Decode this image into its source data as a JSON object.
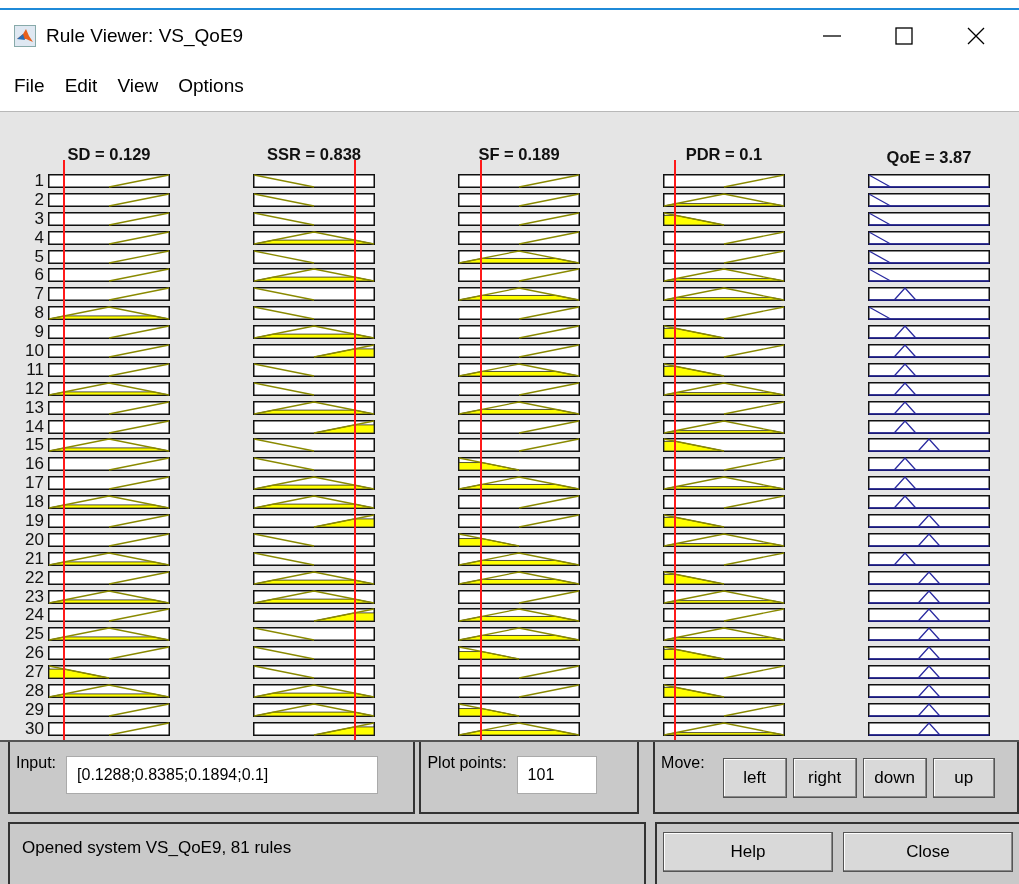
{
  "window": {
    "title": "Rule Viewer: VS_QoE9"
  },
  "menu": [
    "File",
    "Edit",
    "View",
    "Options"
  ],
  "inputs": [
    {
      "label": "SD = 0.129"
    },
    {
      "label": "SSR = 0.838"
    },
    {
      "label": "SF = 0.189"
    },
    {
      "label": "PDR = 0.1"
    }
  ],
  "output": {
    "label": "QoE = 3.87"
  },
  "rules": [
    {
      "number": "1",
      "cells": [
        {
          "kind": "high"
        },
        {
          "kind": "low"
        },
        {
          "kind": "high"
        },
        {
          "kind": "high"
        },
        {
          "kind": "falling"
        }
      ]
    },
    {
      "number": "2",
      "cells": [
        {
          "kind": "high"
        },
        {
          "kind": "low"
        },
        {
          "kind": "high"
        },
        {
          "kind": "mid"
        },
        {
          "kind": "falling"
        }
      ]
    },
    {
      "number": "3",
      "cells": [
        {
          "kind": "high"
        },
        {
          "kind": "low"
        },
        {
          "kind": "high"
        },
        {
          "kind": "low"
        },
        {
          "kind": "falling"
        }
      ]
    },
    {
      "number": "4",
      "cells": [
        {
          "kind": "high"
        },
        {
          "kind": "mid"
        },
        {
          "kind": "high"
        },
        {
          "kind": "high"
        },
        {
          "kind": "falling"
        }
      ]
    },
    {
      "number": "5",
      "cells": [
        {
          "kind": "high"
        },
        {
          "kind": "low"
        },
        {
          "kind": "mid"
        },
        {
          "kind": "high"
        },
        {
          "kind": "falling"
        }
      ]
    },
    {
      "number": "6",
      "cells": [
        {
          "kind": "high"
        },
        {
          "kind": "mid"
        },
        {
          "kind": "high"
        },
        {
          "kind": "mid"
        },
        {
          "kind": "falling"
        }
      ]
    },
    {
      "number": "7",
      "cells": [
        {
          "kind": "high"
        },
        {
          "kind": "low"
        },
        {
          "kind": "mid"
        },
        {
          "kind": "mid"
        },
        {
          "kind": "lowpeak"
        }
      ]
    },
    {
      "number": "8",
      "cells": [
        {
          "kind": "mid"
        },
        {
          "kind": "low"
        },
        {
          "kind": "high"
        },
        {
          "kind": "high"
        },
        {
          "kind": "falling"
        }
      ]
    },
    {
      "number": "9",
      "cells": [
        {
          "kind": "high"
        },
        {
          "kind": "mid"
        },
        {
          "kind": "high"
        },
        {
          "kind": "low"
        },
        {
          "kind": "lowpeak"
        }
      ]
    },
    {
      "number": "10",
      "cells": [
        {
          "kind": "high"
        },
        {
          "kind": "high"
        },
        {
          "kind": "high"
        },
        {
          "kind": "high"
        },
        {
          "kind": "lowpeak"
        }
      ]
    },
    {
      "number": "11",
      "cells": [
        {
          "kind": "high"
        },
        {
          "kind": "low"
        },
        {
          "kind": "mid"
        },
        {
          "kind": "low"
        },
        {
          "kind": "lowpeak"
        }
      ]
    },
    {
      "number": "12",
      "cells": [
        {
          "kind": "mid"
        },
        {
          "kind": "low"
        },
        {
          "kind": "high"
        },
        {
          "kind": "mid"
        },
        {
          "kind": "lowpeak"
        }
      ]
    },
    {
      "number": "13",
      "cells": [
        {
          "kind": "high"
        },
        {
          "kind": "mid"
        },
        {
          "kind": "mid"
        },
        {
          "kind": "high"
        },
        {
          "kind": "lowpeak"
        }
      ]
    },
    {
      "number": "14",
      "cells": [
        {
          "kind": "high"
        },
        {
          "kind": "high"
        },
        {
          "kind": "high"
        },
        {
          "kind": "mid"
        },
        {
          "kind": "lowpeak"
        }
      ]
    },
    {
      "number": "15",
      "cells": [
        {
          "kind": "mid"
        },
        {
          "kind": "low"
        },
        {
          "kind": "high"
        },
        {
          "kind": "low"
        },
        {
          "kind": "midpeak"
        }
      ]
    },
    {
      "number": "16",
      "cells": [
        {
          "kind": "high"
        },
        {
          "kind": "low"
        },
        {
          "kind": "low"
        },
        {
          "kind": "high"
        },
        {
          "kind": "lowpeak"
        }
      ]
    },
    {
      "number": "17",
      "cells": [
        {
          "kind": "high"
        },
        {
          "kind": "mid"
        },
        {
          "kind": "mid"
        },
        {
          "kind": "mid"
        },
        {
          "kind": "lowpeak"
        }
      ]
    },
    {
      "number": "18",
      "cells": [
        {
          "kind": "mid"
        },
        {
          "kind": "mid"
        },
        {
          "kind": "high"
        },
        {
          "kind": "high"
        },
        {
          "kind": "lowpeak"
        }
      ]
    },
    {
      "number": "19",
      "cells": [
        {
          "kind": "high"
        },
        {
          "kind": "high"
        },
        {
          "kind": "high"
        },
        {
          "kind": "low"
        },
        {
          "kind": "midpeak"
        }
      ]
    },
    {
      "number": "20",
      "cells": [
        {
          "kind": "high"
        },
        {
          "kind": "low"
        },
        {
          "kind": "low"
        },
        {
          "kind": "mid"
        },
        {
          "kind": "midpeak"
        }
      ]
    },
    {
      "number": "21",
      "cells": [
        {
          "kind": "mid"
        },
        {
          "kind": "low"
        },
        {
          "kind": "mid"
        },
        {
          "kind": "high"
        },
        {
          "kind": "lowpeak"
        }
      ]
    },
    {
      "number": "22",
      "cells": [
        {
          "kind": "high"
        },
        {
          "kind": "mid"
        },
        {
          "kind": "mid"
        },
        {
          "kind": "low"
        },
        {
          "kind": "midpeak"
        }
      ]
    },
    {
      "number": "23",
      "cells": [
        {
          "kind": "mid"
        },
        {
          "kind": "mid"
        },
        {
          "kind": "high"
        },
        {
          "kind": "mid"
        },
        {
          "kind": "midpeak"
        }
      ]
    },
    {
      "number": "24",
      "cells": [
        {
          "kind": "high"
        },
        {
          "kind": "high"
        },
        {
          "kind": "mid"
        },
        {
          "kind": "high"
        },
        {
          "kind": "midpeak"
        }
      ]
    },
    {
      "number": "25",
      "cells": [
        {
          "kind": "mid"
        },
        {
          "kind": "low"
        },
        {
          "kind": "mid"
        },
        {
          "kind": "mid"
        },
        {
          "kind": "midpeak"
        }
      ]
    },
    {
      "number": "26",
      "cells": [
        {
          "kind": "high"
        },
        {
          "kind": "low"
        },
        {
          "kind": "low"
        },
        {
          "kind": "low"
        },
        {
          "kind": "midpeak"
        }
      ]
    },
    {
      "number": "27",
      "cells": [
        {
          "kind": "low"
        },
        {
          "kind": "low"
        },
        {
          "kind": "high"
        },
        {
          "kind": "high"
        },
        {
          "kind": "midpeak"
        }
      ]
    },
    {
      "number": "28",
      "cells": [
        {
          "kind": "mid"
        },
        {
          "kind": "mid"
        },
        {
          "kind": "high"
        },
        {
          "kind": "low"
        },
        {
          "kind": "midpeak"
        }
      ]
    },
    {
      "number": "29",
      "cells": [
        {
          "kind": "high"
        },
        {
          "kind": "mid"
        },
        {
          "kind": "low"
        },
        {
          "kind": "high"
        },
        {
          "kind": "midpeak"
        }
      ]
    },
    {
      "number": "30",
      "cells": [
        {
          "kind": "high"
        },
        {
          "kind": "high"
        },
        {
          "kind": "mid"
        },
        {
          "kind": "mid"
        },
        {
          "kind": "midpeak"
        }
      ]
    }
  ],
  "input_field": {
    "label": "Input:",
    "value": "[0.1288;0.8385;0.1894;0.1]"
  },
  "plot_points": {
    "label": "Plot points:",
    "value": "101"
  },
  "move": {
    "label": "Move:",
    "buttons": [
      "left",
      "right",
      "down",
      "up"
    ]
  },
  "status": "Opened system VS_QoE9, 81 rules",
  "buttons": [
    "Help",
    "Close"
  ]
}
